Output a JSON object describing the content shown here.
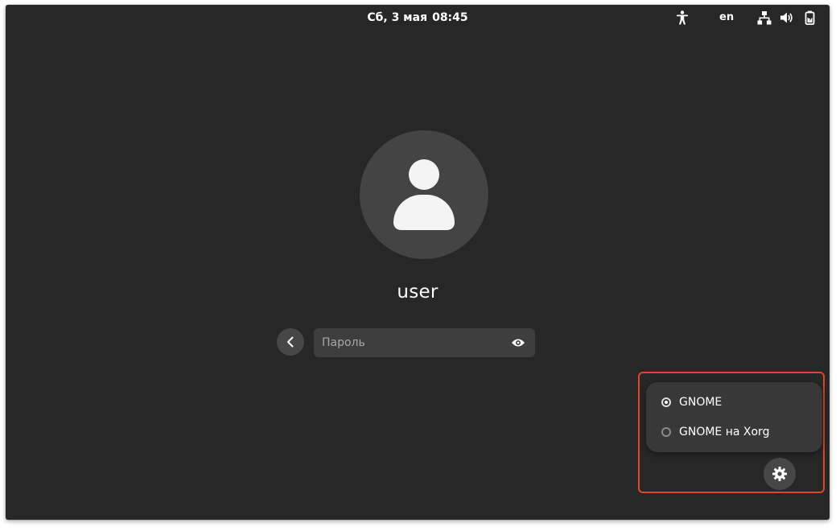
{
  "topbar": {
    "date": "Сб, 3 мая",
    "time": "08:45",
    "language": "en",
    "icons": [
      "accessibility-icon",
      "network-icon",
      "volume-icon",
      "battery-icon"
    ]
  },
  "user": {
    "name": "user"
  },
  "login": {
    "password_placeholder": "Пароль",
    "password_value": ""
  },
  "session_menu": {
    "items": [
      {
        "label": "GNOME",
        "selected": true
      },
      {
        "label": "GNOME на Xorg",
        "selected": false
      }
    ]
  },
  "colors": {
    "background": "#272727",
    "highlight": "#e0452a",
    "avatar_bg": "#444444",
    "entry_bg": "#3e3e3e"
  }
}
